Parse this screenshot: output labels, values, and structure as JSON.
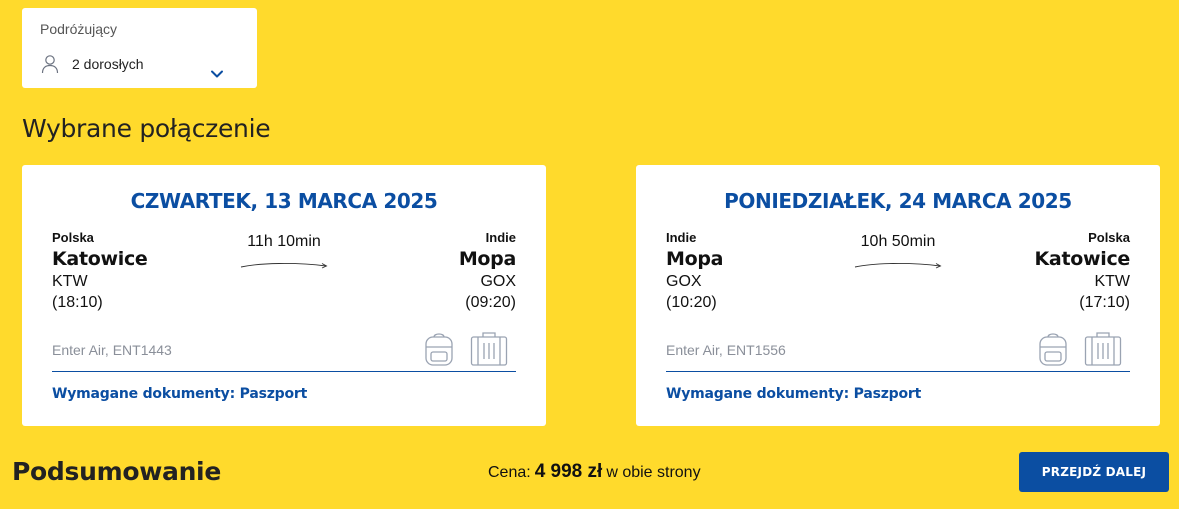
{
  "travelers": {
    "label": "Podróżujący",
    "value": "2 dorosłych",
    "icon": "person-icon"
  },
  "selected_title": "Wybrane połączenie",
  "flights": [
    {
      "date": "CZWARTEK, 13 MARCA 2025",
      "from": {
        "country": "Polska",
        "city": "Katowice",
        "code": "KTW",
        "time": "(18:10)"
      },
      "to": {
        "country": "Indie",
        "city": "Mopa",
        "code": "GOX",
        "time": "(09:20)"
      },
      "duration": "11h 10min",
      "airline": "Enter Air, ENT1443",
      "documents": "Wymagane dokumenty: Paszport"
    },
    {
      "date": "PONIEDZIAŁEK, 24 MARCA 2025",
      "from": {
        "country": "Indie",
        "city": "Mopa",
        "code": "GOX",
        "time": "(10:20)"
      },
      "to": {
        "country": "Polska",
        "city": "Katowice",
        "code": "KTW",
        "time": "(17:10)"
      },
      "duration": "10h 50min",
      "airline": "Enter Air, ENT1556",
      "documents": "Wymagane dokumenty: Paszport"
    }
  ],
  "summary": {
    "title": "Podsumowanie",
    "price_prefix": "Cena:",
    "price_amount": "4 998 zł",
    "price_suffix": "w obie strony",
    "next_button": "PRZEJDŹ DALEJ"
  },
  "colors": {
    "background": "#FFDA2C",
    "accent": "#0B4EA2"
  }
}
